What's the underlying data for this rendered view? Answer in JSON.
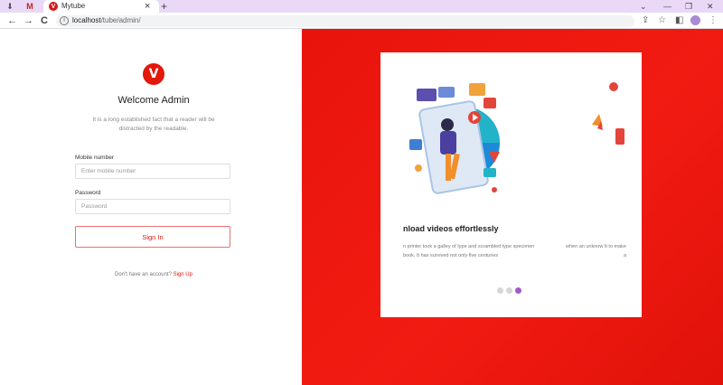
{
  "browser": {
    "tab_title": "Mytube",
    "tab_close": "×",
    "new_tab": "+",
    "url_host": "localhost",
    "url_path": "/tube/admin/",
    "back": "←",
    "forward": "→",
    "reload": "C",
    "min": "—",
    "restore": "❐",
    "close": "✕",
    "chevron": "⌄",
    "share": "⇪",
    "star": "☆",
    "sidepanel": "◧",
    "menu": "⋮"
  },
  "login": {
    "logo_letter": "V",
    "title": "Welcome Admin",
    "intro": "It is a long established fact that a reader will be distracted by the readable.",
    "mobile_label": "Mobile number",
    "mobile_placeholder": "Enter mobile number",
    "password_label": "Password",
    "password_placeholder": "Password",
    "signin_label": "Sign In",
    "no_account": "Don't have an account? ",
    "signup_label": "Sign Up"
  },
  "hero": {
    "slide_title": "nload videos effortlessly",
    "slide_text": "n printer took a galley of type and scrambled type specimen book. It has survived not only five centuries",
    "slide_text_right": "when an unknow It to make a",
    "dots": [
      false,
      false,
      true
    ]
  },
  "colors": {
    "brand_red": "#e3170a",
    "active_dot": "#a259c9"
  }
}
